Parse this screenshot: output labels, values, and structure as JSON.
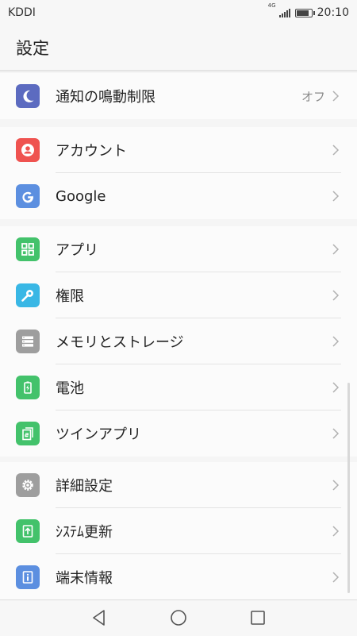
{
  "status_bar": {
    "carrier": "KDDI",
    "network": "4G",
    "time": "20:10",
    "battery_level": 0.85
  },
  "header": {
    "title": "設定"
  },
  "groups": [
    {
      "items": [
        {
          "label": "通知の鳴動制限",
          "value": "オフ",
          "icon": "moon-icon",
          "color": "#5c6bc0"
        }
      ]
    },
    {
      "items": [
        {
          "label": "アカウント",
          "icon": "account-icon",
          "color": "#ef5350"
        },
        {
          "label": "Google",
          "icon": "google-icon",
          "color": "#5c8fe0"
        }
      ]
    },
    {
      "items": [
        {
          "label": "アプリ",
          "icon": "apps-icon",
          "color": "#43c26b"
        },
        {
          "label": "権限",
          "icon": "key-icon",
          "color": "#39b7e5"
        },
        {
          "label": "メモリとストレージ",
          "icon": "storage-icon",
          "color": "#9e9e9e"
        },
        {
          "label": "電池",
          "icon": "battery-icon",
          "color": "#43c26b"
        },
        {
          "label": "ツインアプリ",
          "icon": "twin-app-icon",
          "color": "#43c26b"
        }
      ]
    },
    {
      "items": [
        {
          "label": "詳細設定",
          "icon": "gear-icon",
          "color": "#9e9e9e"
        },
        {
          "label": "ｼｽﾃﾑ更新",
          "icon": "system-update-icon",
          "color": "#43c26b"
        },
        {
          "label": "端末情報",
          "icon": "info-icon",
          "color": "#5c8fe0"
        }
      ]
    }
  ],
  "navbar": {
    "back": "back-icon",
    "home": "home-icon",
    "recents": "recents-icon"
  }
}
